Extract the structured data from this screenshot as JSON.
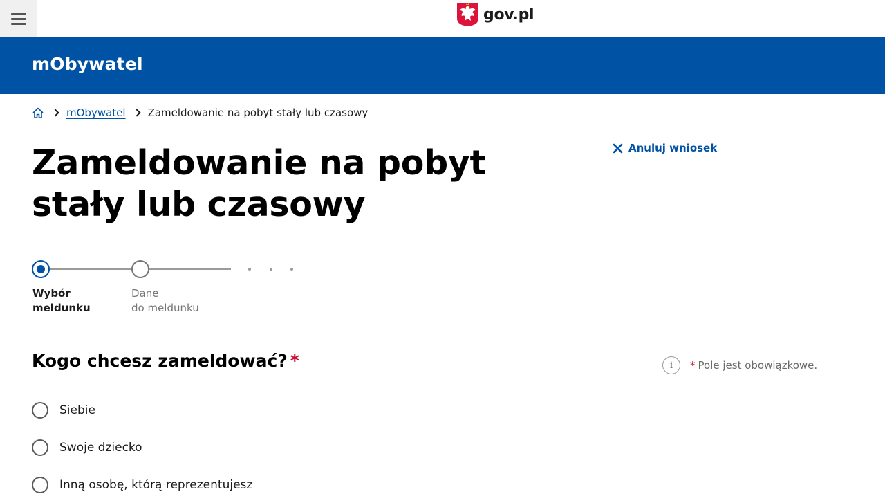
{
  "topbar": {
    "menu_icon": "hamburger-menu-icon",
    "brand_logo_icon": "polish-eagle-emblem-icon",
    "brand_text": "gov.pl"
  },
  "header": {
    "app_title": "mObywatel",
    "background_color": "#0052a5"
  },
  "breadcrumb": {
    "home_icon": "home-icon",
    "items": [
      "mObywatel",
      "Zameldowanie na pobyt stały lub czasowy"
    ]
  },
  "cancel": {
    "label": "Anuluj wniosek",
    "icon": "close-icon"
  },
  "page_title": "Zameldowanie na pobyt stały lub czasowy",
  "stepper": {
    "steps": [
      {
        "line1": "Wybór",
        "line2": "meldunku",
        "state": "active"
      },
      {
        "line1": "Dane",
        "line2": "do meldunku",
        "state": "inactive"
      }
    ],
    "more_indicator": "· · ·"
  },
  "form": {
    "question": "Kogo chcesz zameldować?",
    "required_mark": "*",
    "required_note_star": "*",
    "required_note": "Pole jest obowiązkowe.",
    "info_icon": "info-icon",
    "options": [
      "Siebie",
      "Swoje dziecko",
      "Inną osobę, którą reprezentujesz"
    ]
  }
}
